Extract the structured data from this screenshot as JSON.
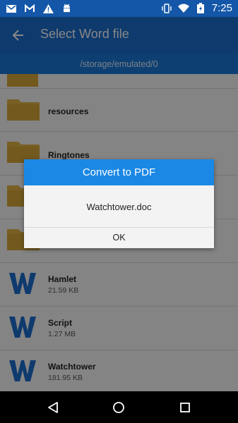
{
  "status_bar": {
    "time": "7:25"
  },
  "app_bar": {
    "title": "Select Word file"
  },
  "path": "/storage/emulated/0",
  "files": [
    {
      "name": "resources",
      "type": "folder"
    },
    {
      "name": "Ringtones",
      "type": "folder"
    },
    {
      "name": "Hamlet",
      "size": "21.59 KB",
      "type": "word"
    },
    {
      "name": "Script",
      "size": "1.27 MB",
      "type": "word"
    },
    {
      "name": "Watchtower",
      "size": "181.95 KB",
      "type": "word"
    }
  ],
  "dialog": {
    "title": "Convert to PDF",
    "message": "Watchtower.doc",
    "ok_label": "OK"
  },
  "colors": {
    "status_bar": "#1457a8",
    "app_bar": "#1b6fcf",
    "path_bar": "#1a78d7",
    "dialog_title": "#1b88e5",
    "folder": "#e2b445",
    "word_icon": "#1e6fd0"
  }
}
